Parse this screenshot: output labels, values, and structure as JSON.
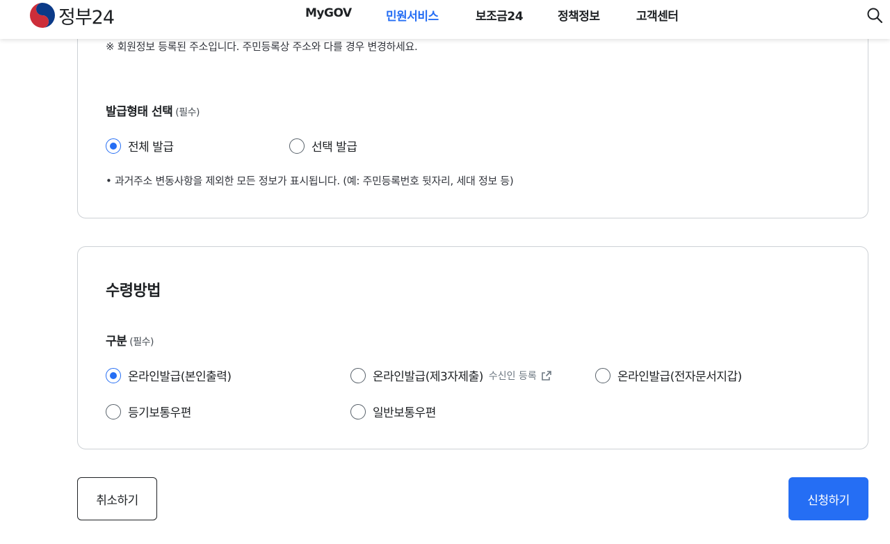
{
  "header": {
    "logo_text": "정부24",
    "nav": [
      {
        "label": "MyGOV",
        "active": false
      },
      {
        "label": "민원서비스",
        "active": true
      },
      {
        "label": "보조금24",
        "active": false
      },
      {
        "label": "정책정보",
        "active": false
      },
      {
        "label": "고객센터",
        "active": false
      }
    ],
    "search_icon": "search-icon"
  },
  "address_note": "※ 회원정보 등록된 주소입니다. 주민등록상 주소와 다를 경우 변경하세요.",
  "issue_type": {
    "label": "발급형태 선택",
    "required": "(필수)",
    "options": [
      {
        "label": "전체 발급",
        "checked": true
      },
      {
        "label": "선택 발급",
        "checked": false
      }
    ],
    "note": "• 과거주소 변동사항을 제외한 모든 정보가 표시됩니다. (예: 주민등록번호 뒷자리, 세대 정보 등)"
  },
  "receipt": {
    "title": "수령방법",
    "label": "구분",
    "required": "(필수)",
    "options": [
      {
        "label": "온라인발급(본인출력)",
        "checked": true
      },
      {
        "label": "온라인발급(제3자제출)",
        "checked": false,
        "extra": "수신인 등록",
        "extra_icon": "external-link-icon"
      },
      {
        "label": "온라인발급(전자문서지갑)",
        "checked": false
      },
      {
        "label": "등기보통우편",
        "checked": false
      },
      {
        "label": "일반보통우편",
        "checked": false
      }
    ]
  },
  "buttons": {
    "cancel": "취소하기",
    "submit": "신청하기"
  },
  "colors": {
    "primary": "#256ef4",
    "text": "#1e2124",
    "border": "#cdd1d5"
  }
}
